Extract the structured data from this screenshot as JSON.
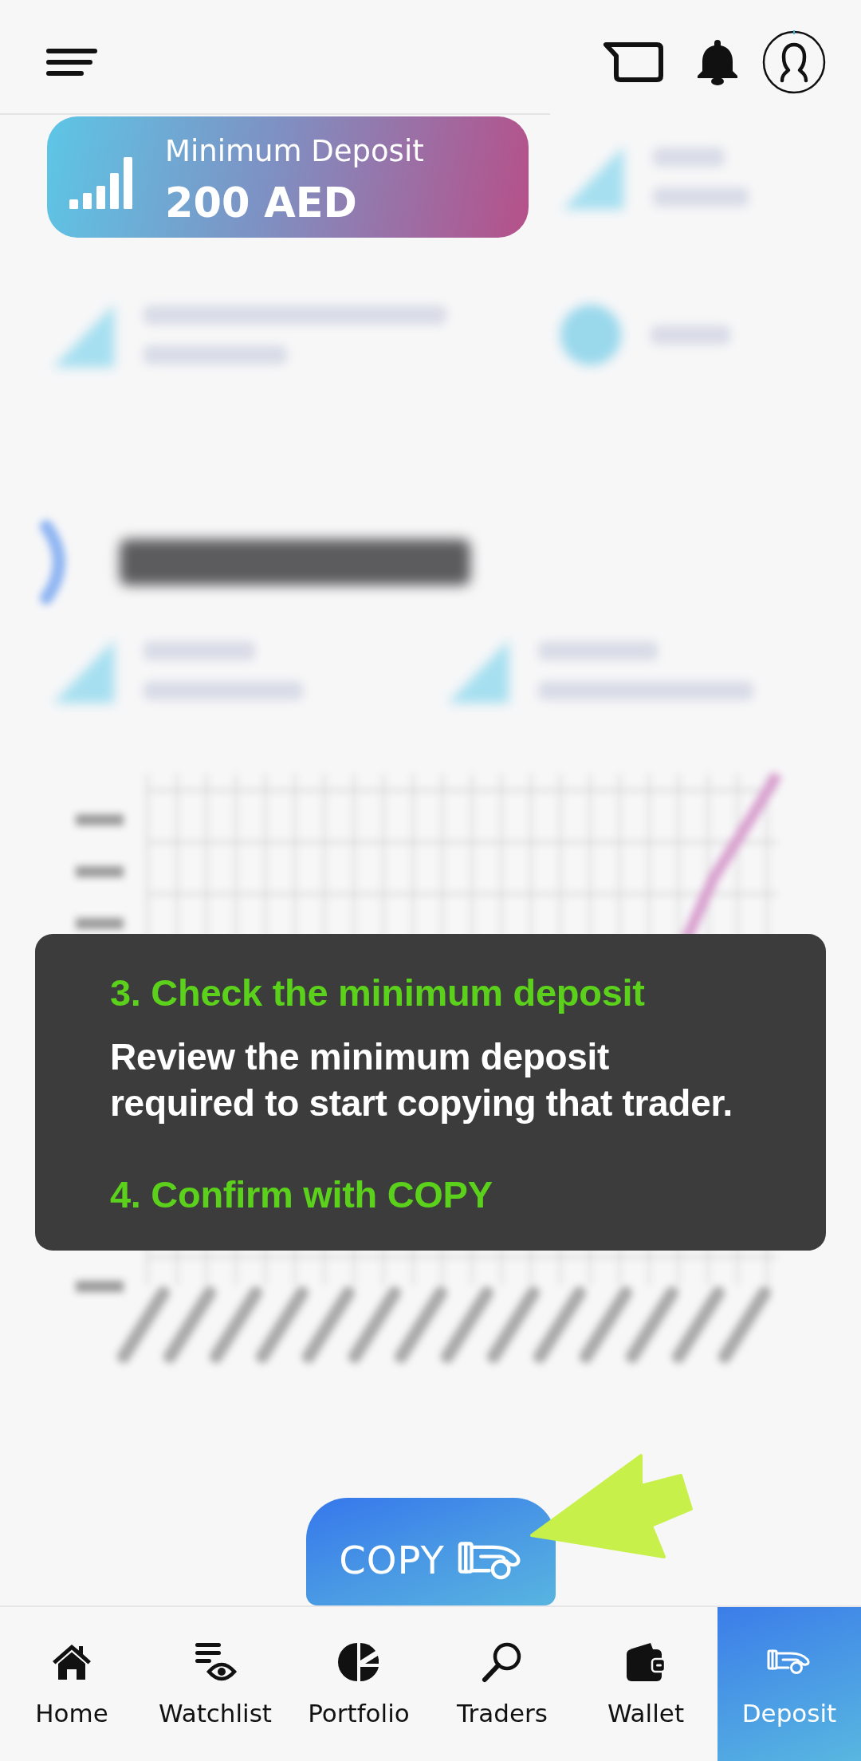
{
  "deposit_card": {
    "label": "Minimum Deposit",
    "value": "200 AED"
  },
  "tooltip": {
    "steps": [
      {
        "kind": "heading",
        "text": "3. Check the minimum deposit"
      },
      {
        "kind": "body",
        "text": "Review the minimum deposit required to start copying that trader."
      },
      {
        "kind": "heading",
        "text": "4. Confirm with COPY"
      }
    ]
  },
  "copy_button": {
    "label": "COPY"
  },
  "bottom_nav": [
    {
      "label": "Home",
      "selected": false
    },
    {
      "label": "Watchlist",
      "selected": false
    },
    {
      "label": "Portfolio",
      "selected": false
    },
    {
      "label": "Traders",
      "selected": false
    },
    {
      "label": "Wallet",
      "selected": false
    },
    {
      "label": "Deposit",
      "selected": true
    }
  ]
}
